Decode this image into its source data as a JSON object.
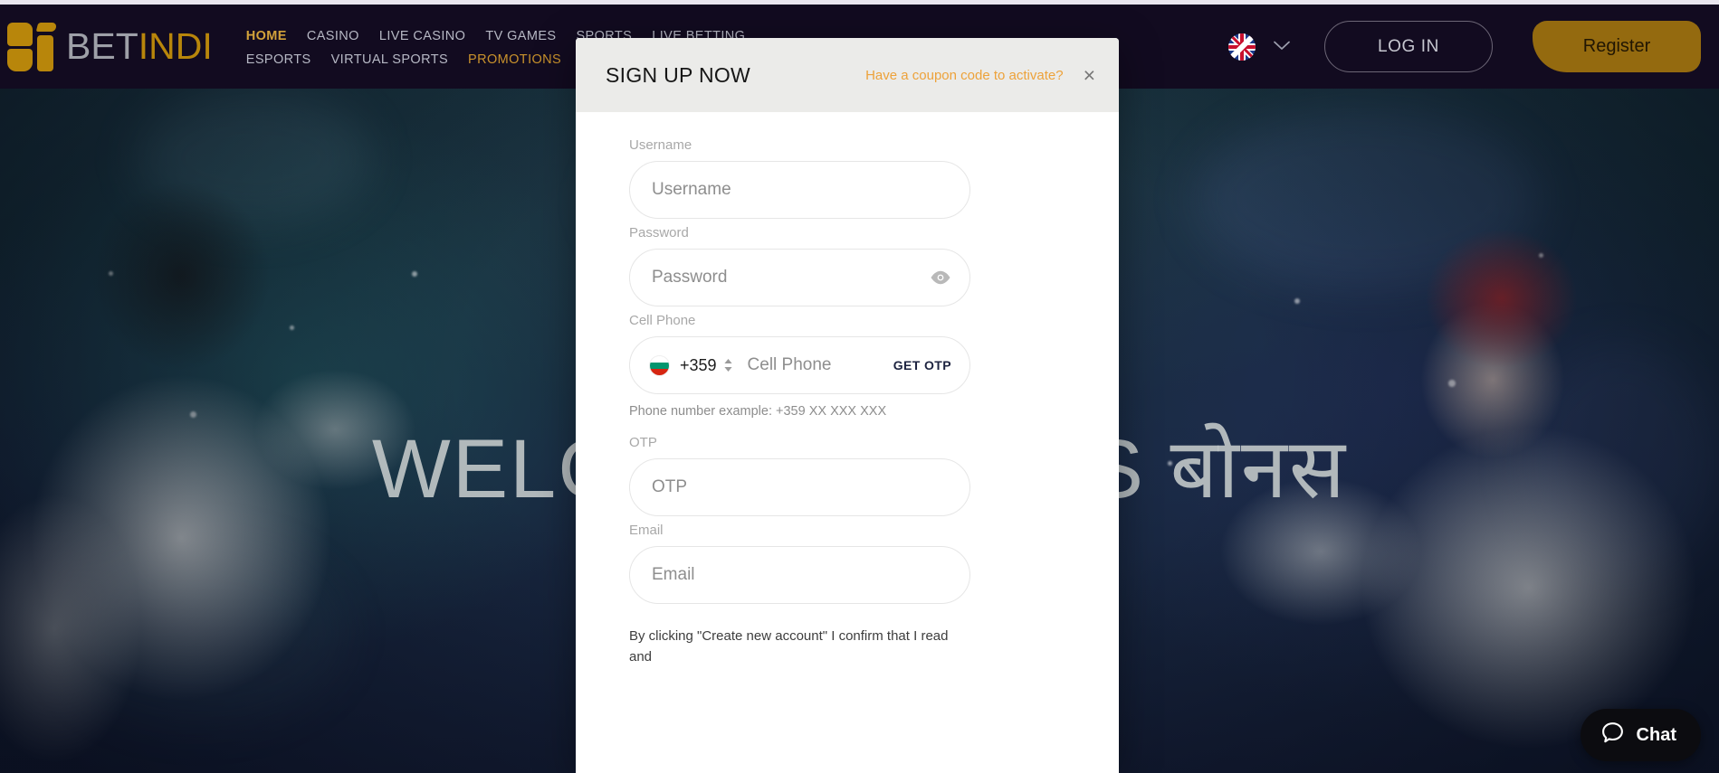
{
  "header": {
    "logo": {
      "part1": "BET",
      "part2": "INDI",
      "icon": "betindi-logo-icon"
    },
    "nav": [
      {
        "label": "HOME",
        "state": "active"
      },
      {
        "label": "CASINO",
        "state": "normal"
      },
      {
        "label": "LIVE CASINO",
        "state": "normal"
      },
      {
        "label": "TV GAMES",
        "state": "normal"
      },
      {
        "label": "SPORTS",
        "state": "normal"
      },
      {
        "label": "LIVE BETTING",
        "state": "normal"
      },
      {
        "label": "ESPORTS",
        "state": "normal"
      },
      {
        "label": "VIRTUAL SPORTS",
        "state": "normal"
      },
      {
        "label": "PROMOTIONS",
        "state": "promo"
      }
    ],
    "language": {
      "flag": "uk-flag-icon",
      "caret": "⌄"
    },
    "login_label": "LOG IN",
    "register_label": "Register"
  },
  "hero": {
    "headline": "WELCOME BONUS बोनस"
  },
  "modal": {
    "title": "SIGN UP NOW",
    "coupon_link": "Have a coupon code to activate?",
    "close_icon": "×",
    "fields": {
      "username": {
        "label": "Username",
        "placeholder": "Username",
        "value": ""
      },
      "password": {
        "label": "Password",
        "placeholder": "Password",
        "value": "",
        "reveal_icon": "eye-icon"
      },
      "cell_phone": {
        "label": "Cell Phone",
        "placeholder": "Cell Phone",
        "value": "",
        "dial_code": "+359",
        "country_flag": "bulgaria-flag-icon",
        "get_otp_label": "GET OTP",
        "hint": "Phone number example: +359 XX XXX XXX"
      },
      "otp": {
        "label": "OTP",
        "placeholder": "OTP",
        "value": ""
      },
      "email": {
        "label": "Email",
        "placeholder": "Email",
        "value": ""
      }
    },
    "terms_text": "By clicking \"Create new account\" I confirm that I read and"
  },
  "chat": {
    "label": "Chat",
    "icon": "speech-bubble-icon"
  },
  "colors": {
    "brand_gold": "#b8860b",
    "register_bg": "#946a0f",
    "header_bg": "#120b20",
    "coupon_orange": "#eda23a",
    "modal_head_bg": "#ebebe9",
    "get_otp": "#1d2340"
  }
}
